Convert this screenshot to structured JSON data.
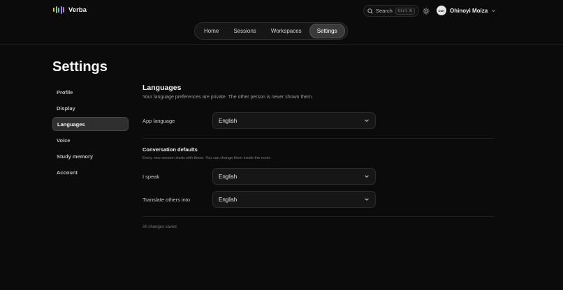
{
  "brand": {
    "name": "Verba",
    "bar_colors": [
      "#f2c230",
      "#7fd46a",
      "#4ac3d6",
      "#8e8ef0",
      "#d070d8"
    ]
  },
  "nav": {
    "tabs": [
      {
        "label": "Home"
      },
      {
        "label": "Sessions"
      },
      {
        "label": "Workspaces"
      },
      {
        "label": "Settings",
        "active": true
      }
    ]
  },
  "header": {
    "search_label": "Search",
    "search_shortcut": "Ctrl K",
    "user_name": "Ohinoyi Moiza",
    "avatar_text": "OSIT"
  },
  "page": {
    "title": "Settings"
  },
  "sidebar": {
    "items": [
      {
        "label": "Profile"
      },
      {
        "label": "Display"
      },
      {
        "label": "Languages",
        "active": true
      },
      {
        "label": "Voice"
      },
      {
        "label": "Study memory"
      },
      {
        "label": "Account"
      }
    ]
  },
  "languages": {
    "title": "Languages",
    "description": "Your language preferences are private. The other person is never shown them.",
    "app_language_label": "App language",
    "app_language_value": "English"
  },
  "defaults": {
    "title": "Conversation defaults",
    "description": "Every new session starts with these. You can change them inside the room.",
    "speak_label": "I speak",
    "speak_value": "English",
    "translate_label": "Translate others into",
    "translate_value": "English"
  },
  "status": {
    "saved_text": "All changes saved"
  }
}
